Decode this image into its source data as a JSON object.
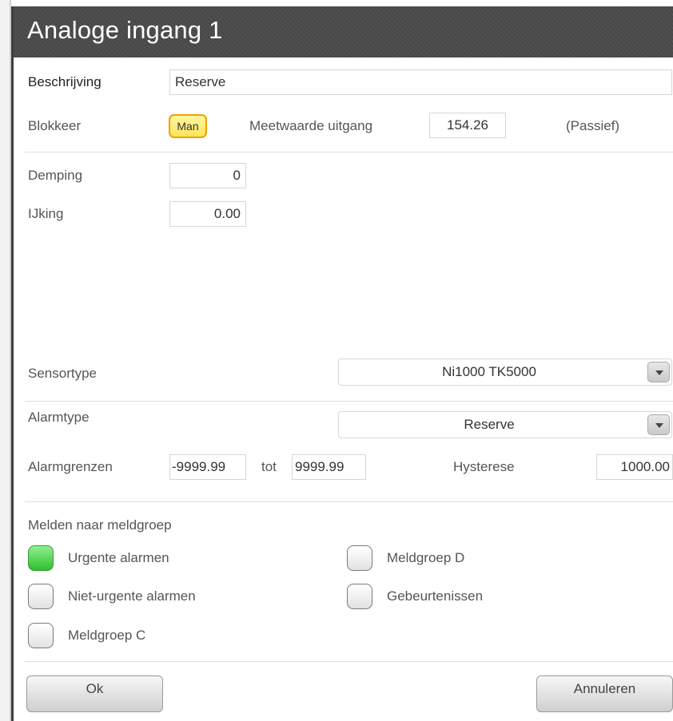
{
  "dialog": {
    "title": "Analoge ingang 1"
  },
  "fields": {
    "beschrijving_label": "Beschrijving",
    "beschrijving_value": "Reserve",
    "blokkeer_label": "Blokkeer",
    "blokkeer_button": "Man",
    "meetwaarde_label": "Meetwaarde uitgang",
    "meetwaarde_value": "154.26",
    "passief_label": "(Passief)",
    "demping_label": "Demping",
    "demping_value": "0",
    "ijking_label": "IJking",
    "ijking_value": "0.00"
  },
  "sensor": {
    "label": "Sensortype",
    "selected": "Ni1000 TK5000"
  },
  "alarm": {
    "type_label": "Alarmtype",
    "type_selected": "Reserve",
    "limits_label": "Alarmgrenzen",
    "low_value": "-9999.99",
    "tot_label": "tot",
    "high_value": "9999.99",
    "hysterese_label": "Hysterese",
    "hysterese_value": "1000.00"
  },
  "melden": {
    "title": "Melden naar meldgroep",
    "items": [
      {
        "label": "Urgente alarmen",
        "checked": true
      },
      {
        "label": "Niet-urgente alarmen",
        "checked": false
      },
      {
        "label": "Meldgroep C",
        "checked": false
      },
      {
        "label": "Meldgroep D",
        "checked": false
      },
      {
        "label": "Gebeurtenissen",
        "checked": false
      }
    ]
  },
  "buttons": {
    "ok": "Ok",
    "cancel": "Annuleren"
  },
  "colors": {
    "title_bar": "#4a4a4a",
    "man_button": "#ffe45a",
    "checked": "#2fbf2f"
  }
}
